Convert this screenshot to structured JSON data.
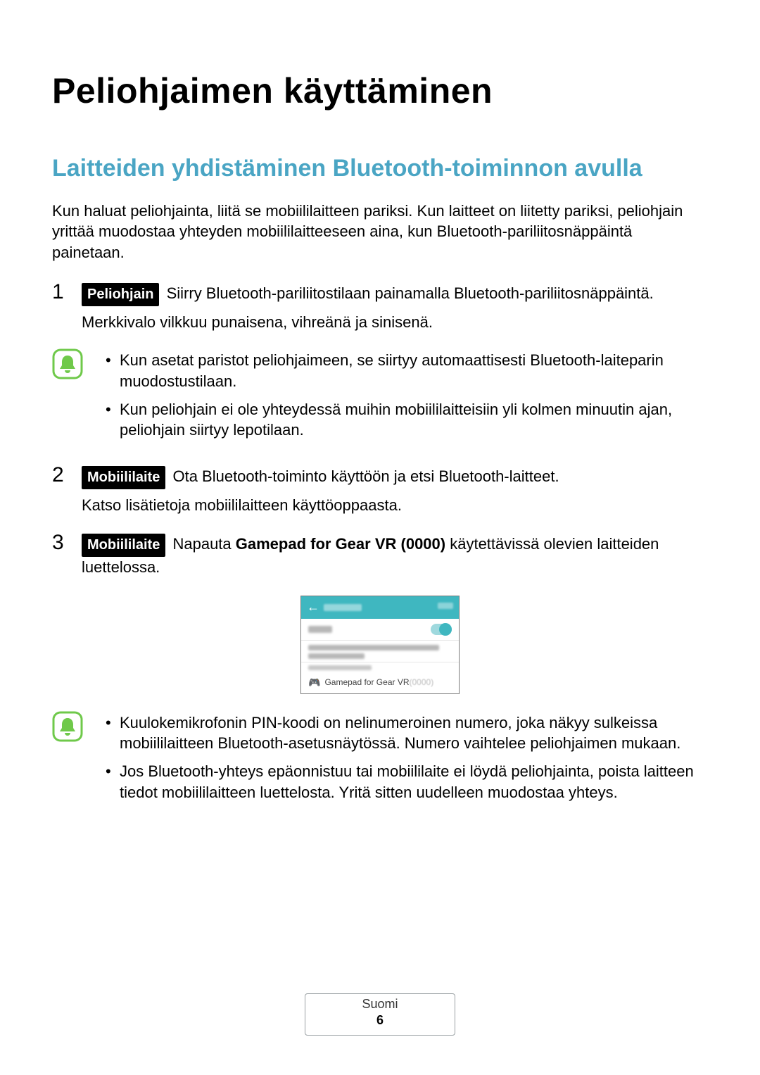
{
  "title": "Peliohjaimen käyttäminen",
  "subtitle": "Laitteiden yhdistäminen Bluetooth-toiminnon avulla",
  "intro": "Kun haluat peliohjainta, liitä se mobiililaitteen pariksi. Kun laitteet on liitetty pariksi, peliohjain yrittää muodostaa yhteyden mobiililaitteeseen aina, kun Bluetooth-pariliitosnäppäintä painetaan.",
  "steps": {
    "s1": {
      "num": "1",
      "pill": "Peliohjain",
      "line1": "Siirry Bluetooth-pariliitostilaan painamalla Bluetooth-pariliitosnäppäintä.",
      "line2": "Merkkivalo vilkkuu punaisena, vihreänä ja sinisenä."
    },
    "s2": {
      "num": "2",
      "pill": "Mobiililaite",
      "line1": "Ota Bluetooth-toiminto käyttöön ja etsi Bluetooth-laitteet.",
      "line2": "Katso lisätietoja mobiililaitteen käyttöoppaasta."
    },
    "s3": {
      "num": "3",
      "pill": "Mobiililaite",
      "prefix": "Napauta ",
      "bold": "Gamepad for Gear VR (0000)",
      "suffix": " käytettävissä olevien laitteiden luettelossa."
    }
  },
  "note1": {
    "b1": "Kun asetat paristot peliohjaimeen, se siirtyy automaattisesti Bluetooth-laiteparin muodostustilaan.",
    "b2": "Kun peliohjain ei ole yhteydessä muihin mobiililaitteisiin yli kolmen minuutin ajan, peliohjain siirtyy lepotilaan."
  },
  "note2": {
    "b1": "Kuulokemikrofonin PIN-koodi on nelinumeroinen numero, joka näkyy sulkeissa mobiililaitteen Bluetooth-asetusnäytössä. Numero vaihtelee peliohjaimen mukaan.",
    "b2": "Jos Bluetooth-yhteys epäonnistuu tai mobiililaite ei löydä peliohjainta, poista laitteen tiedot mobiililaitteen luettelosta. Yritä sitten uudelleen muodostaa yhteys."
  },
  "phone": {
    "device_prefix": "Gamepad for Gear VR ",
    "device_suffix": "(0000)"
  },
  "footer": {
    "lang": "Suomi",
    "page": "6"
  }
}
